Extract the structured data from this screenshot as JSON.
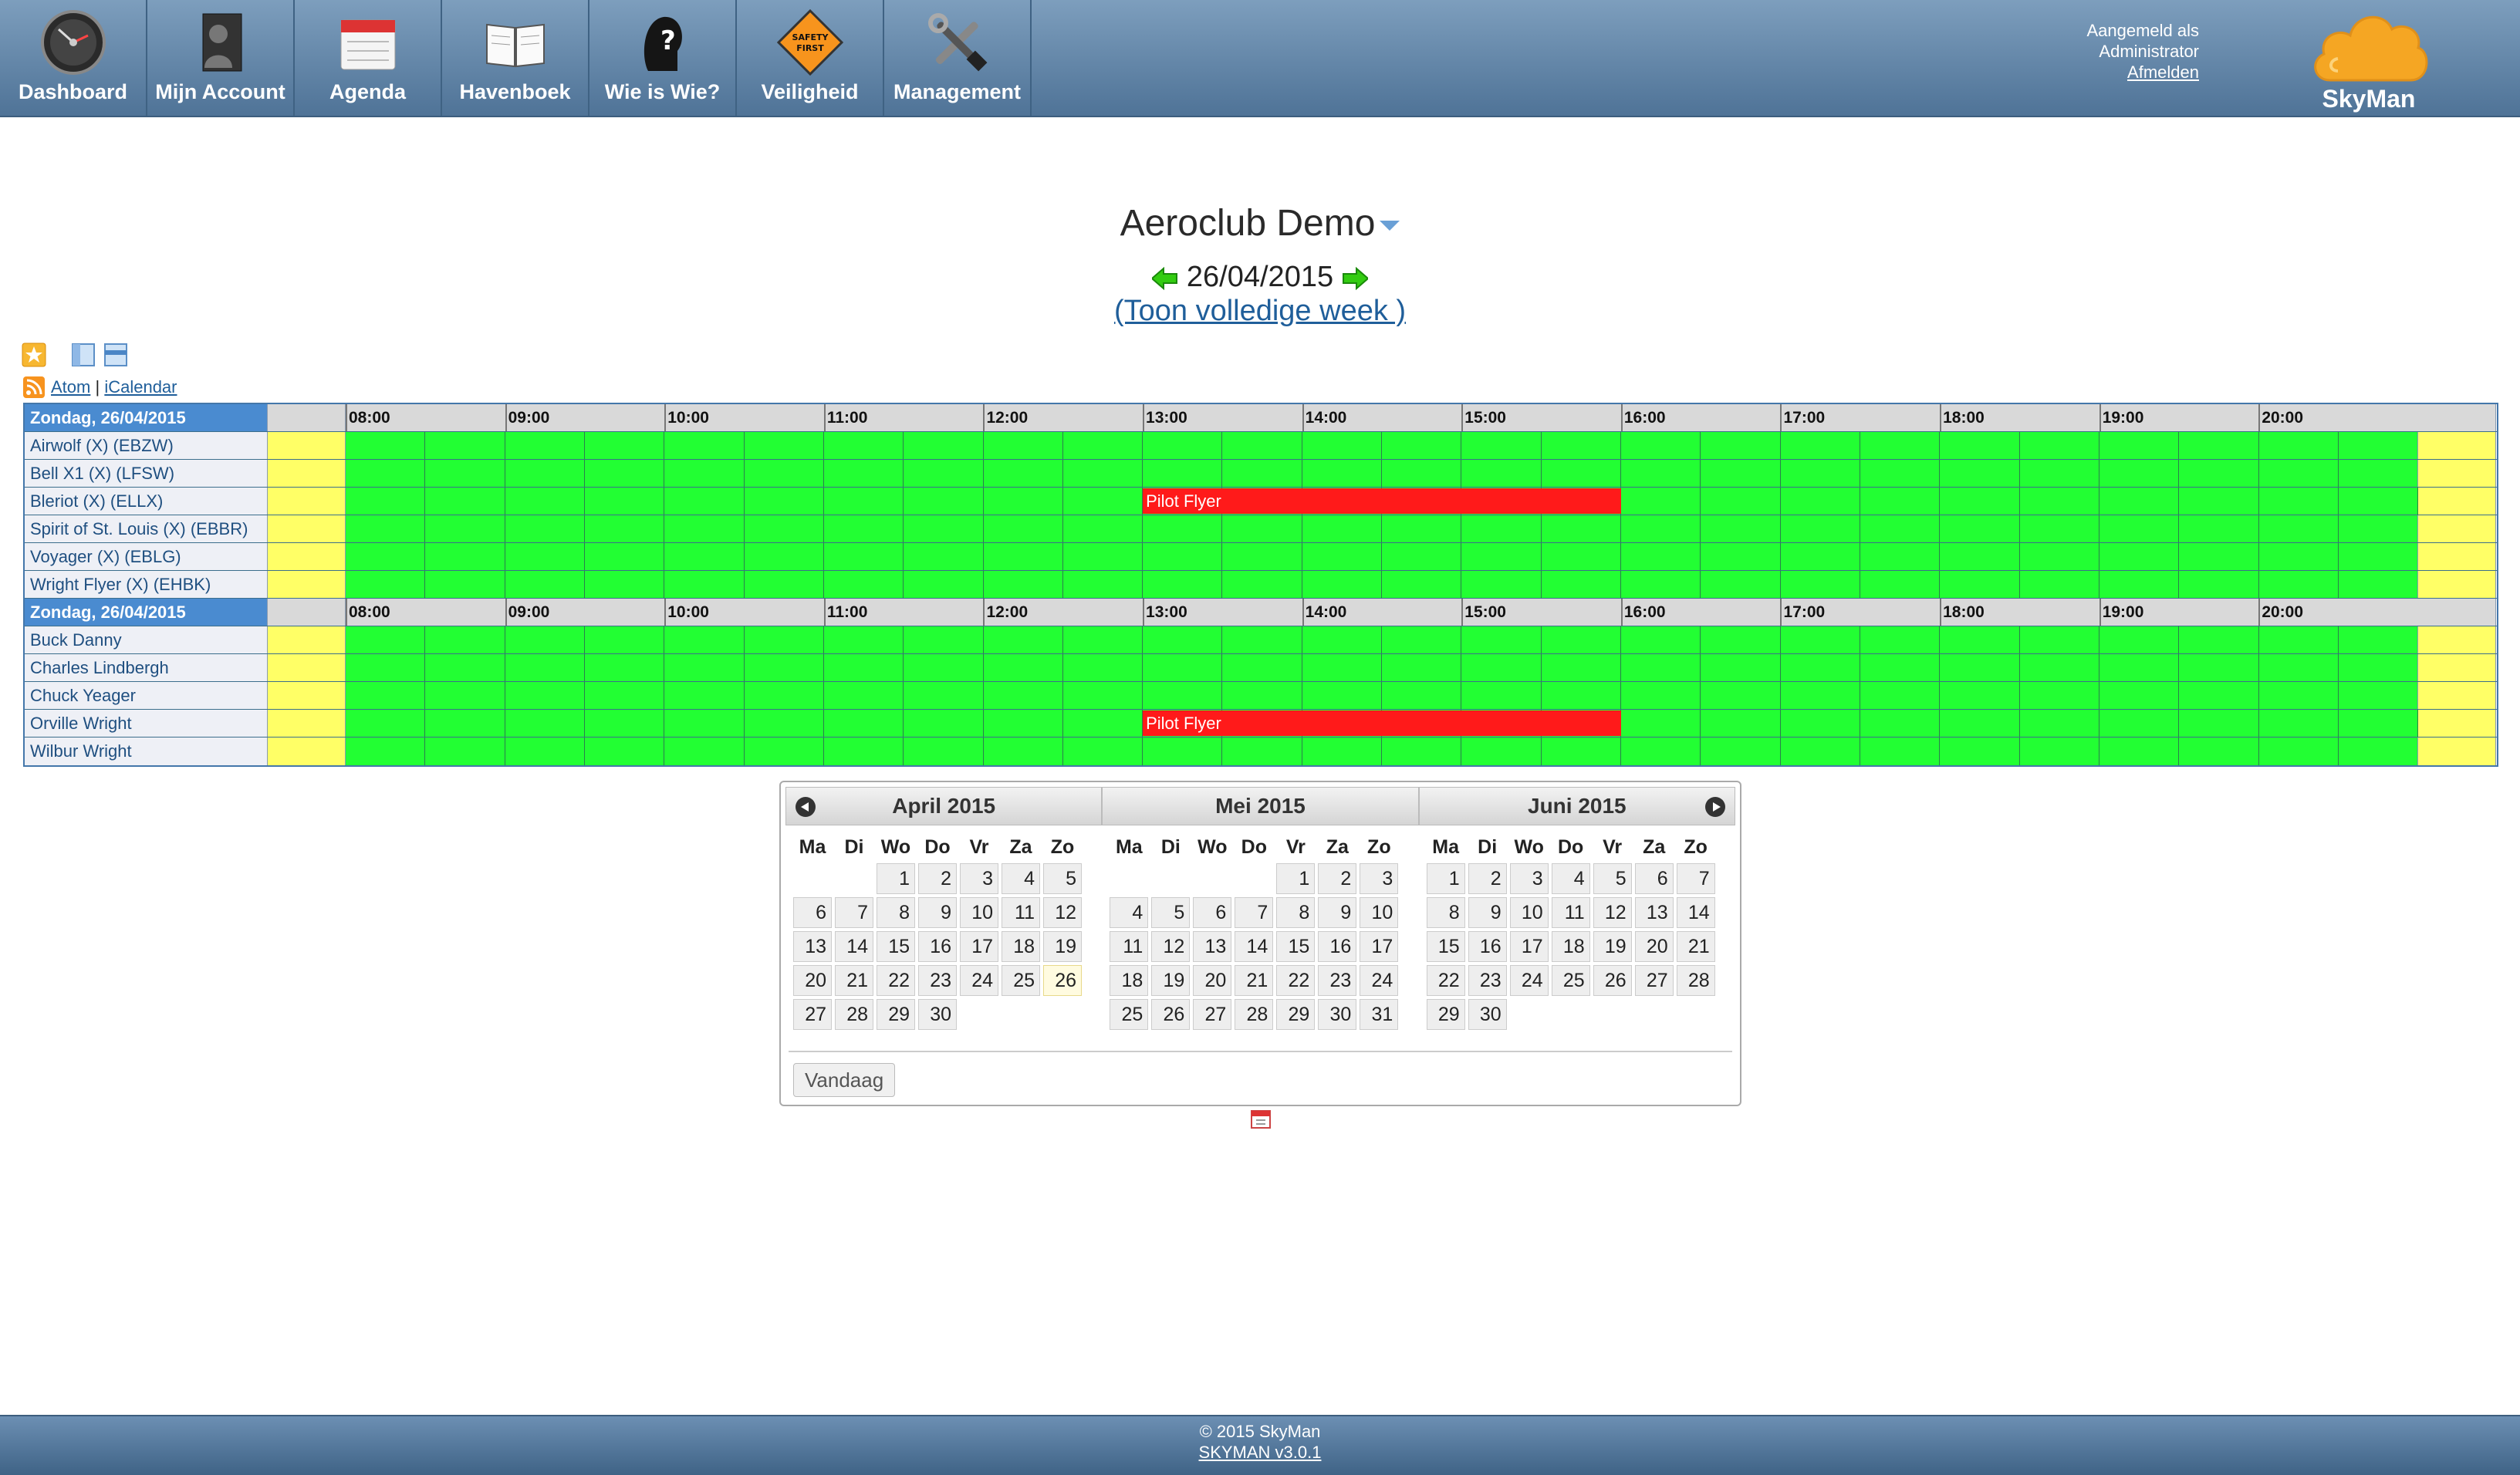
{
  "nav": {
    "items": [
      {
        "label": "Dashboard",
        "icon": "dashboard-gauge-icon"
      },
      {
        "label": "Mijn Account",
        "icon": "account-person-icon"
      },
      {
        "label": "Agenda",
        "icon": "calendar-icon"
      },
      {
        "label": "Havenboek",
        "icon": "book-icon"
      },
      {
        "label": "Wie is Wie?",
        "icon": "question-head-icon"
      },
      {
        "label": "Veiligheid",
        "icon": "safety-first-sign-icon"
      },
      {
        "label": "Management",
        "icon": "tools-icon"
      }
    ],
    "safety_sign_text": "SAFETY FIRST"
  },
  "user": {
    "line1": "Aangemeld als",
    "line2": "Administrator",
    "logout": "Afmelden"
  },
  "brand": {
    "name": "SkyMan"
  },
  "club": {
    "title": "Aeroclub Demo"
  },
  "date": {
    "current": "26/04/2015",
    "week_link": "(Toon volledige week )"
  },
  "feeds": {
    "atom": "Atom",
    "sep": "|",
    "ical": "iCalendar"
  },
  "schedule": {
    "hours": [
      "08:00",
      "09:00",
      "10:00",
      "11:00",
      "12:00",
      "13:00",
      "14:00",
      "15:00",
      "16:00",
      "17:00",
      "18:00",
      "19:00",
      "20:00"
    ],
    "sections": [
      {
        "header": "Zondag, 26/04/2015",
        "rows": [
          {
            "label": "Airwolf (X) (EBZW)",
            "bookings": []
          },
          {
            "label": "Bell X1 (X) (LFSW)",
            "bookings": []
          },
          {
            "label": "Bleriot (X) (ELLX)",
            "bookings": [
              {
                "label": "Pilot Flyer",
                "start": "13:00",
                "end": "16:00"
              }
            ]
          },
          {
            "label": "Spirit of St. Louis (X) (EBBR)",
            "bookings": []
          },
          {
            "label": "Voyager (X) (EBLG)",
            "bookings": []
          },
          {
            "label": "Wright Flyer (X) (EHBK)",
            "bookings": []
          }
        ]
      },
      {
        "header": "Zondag, 26/04/2015",
        "rows": [
          {
            "label": "Buck Danny",
            "bookings": []
          },
          {
            "label": "Charles Lindbergh",
            "bookings": []
          },
          {
            "label": "Chuck Yeager",
            "bookings": []
          },
          {
            "label": "Orville Wright",
            "bookings": [
              {
                "label": "Pilot Flyer",
                "start": "13:00",
                "end": "16:00"
              }
            ]
          },
          {
            "label": "Wilbur Wright",
            "bookings": []
          }
        ]
      }
    ],
    "colors": {
      "free": "#22ff33",
      "booked": "#ff1a1a",
      "offhours": "#ffff66"
    }
  },
  "datepicker": {
    "dow": [
      "Ma",
      "Di",
      "Wo",
      "Do",
      "Vr",
      "Za",
      "Zo"
    ],
    "months": [
      {
        "title": "April 2015",
        "offset": 2,
        "days": 30
      },
      {
        "title": "Mei 2015",
        "offset": 4,
        "days": 31
      },
      {
        "title": "Juni 2015",
        "offset": 0,
        "days": 30
      }
    ],
    "today_day": 26,
    "today_month": 0,
    "today_button": "Vandaag"
  },
  "footer": {
    "copyright": "© 2015 SkyMan",
    "version": "SKYMAN v3.0.1"
  }
}
